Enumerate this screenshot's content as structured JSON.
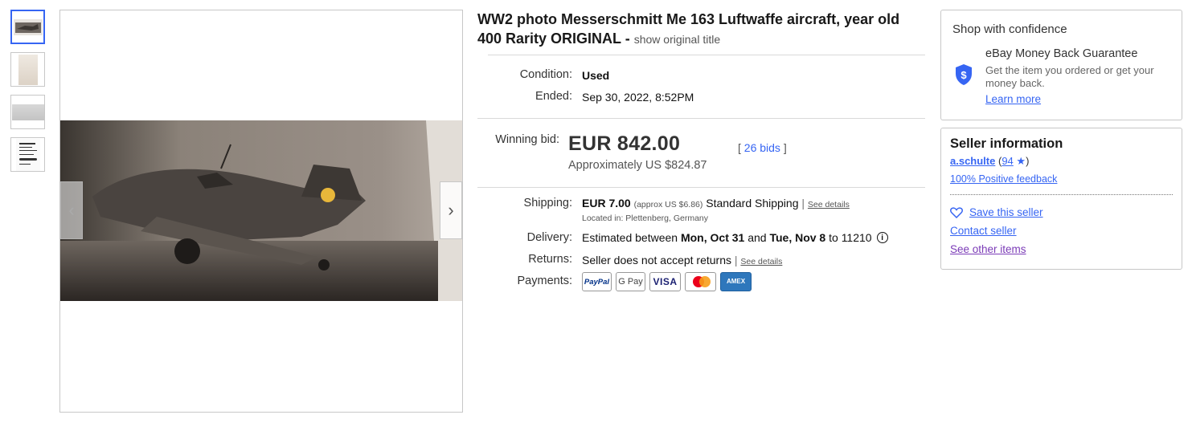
{
  "gallery": {
    "thumbnails": [
      "thumbnail-1",
      "thumbnail-2",
      "thumbnail-3",
      "thumbnail-4"
    ],
    "prev_arrow": "‹",
    "next_arrow": "›"
  },
  "listing": {
    "title_main": "WW2 photo Messerschmitt Me 163 Luftwaffe aircraft, year old 400 Rarity ORIGINAL - ",
    "title_orig_link": "show original title",
    "condition_label": "Condition:",
    "condition_value": "Used",
    "ended_label": "Ended:",
    "ended_value": "Sep 30, 2022, 8:52PM",
    "winning_label": "Winning bid:",
    "winning_price": "EUR 842.00",
    "winning_approx": "Approximately US $824.87",
    "bids_open": "[ ",
    "bids_count": "26 bids",
    "bids_close": " ]"
  },
  "shipping": {
    "label": "Shipping:",
    "price": "EUR 7.00",
    "approx": "(approx US $6.86)",
    "method": "Standard Shipping",
    "separator": "|",
    "details_link": "See details",
    "located": "Located in: Plettenberg, Germany"
  },
  "delivery": {
    "label": "Delivery:",
    "prefix": "Estimated between ",
    "date1": "Mon, Oct 31",
    "and": " and ",
    "date2": "Tue, Nov 8",
    "to": " to 11210",
    "info_icon": "i"
  },
  "returns": {
    "label": "Returns:",
    "value": "Seller does not accept returns",
    "separator": "|",
    "details_link": "See details"
  },
  "payments": {
    "label": "Payments:",
    "methods": [
      "PayPal",
      "G Pay",
      "VISA",
      "mastercard",
      "AMEX"
    ]
  },
  "confidence": {
    "title": "Shop with confidence",
    "guarantee_title": "eBay Money Back Guarantee",
    "guarantee_desc": "Get the item you ordered or get your money back.",
    "learn_more": "Learn more"
  },
  "seller": {
    "title": "Seller information",
    "username": "a.schulte",
    "score_open": " (",
    "score": "94",
    "score_close": ")",
    "feedback": "100% Positive feedback",
    "save": "Save this seller",
    "contact": "Contact seller",
    "other": "See other items"
  },
  "colors": {
    "link": "#3665f3",
    "visited": "#7b3bb7",
    "paypal": "#003087",
    "visa": "#1a1f71",
    "amex": "#2e77bc"
  }
}
